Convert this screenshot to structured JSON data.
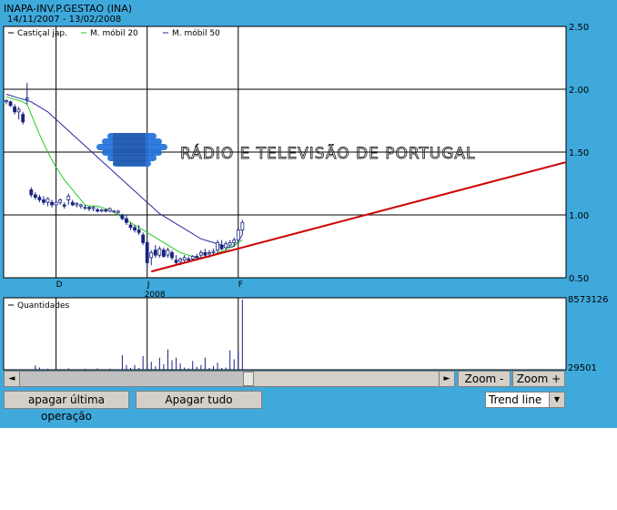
{
  "header": {
    "title": "INAPA-INV.P.GESTAO (INA)",
    "date_range": "14/11/2007 - 13/02/2008"
  },
  "legend": {
    "candles": "Castiçal jap.",
    "ma20": "M. móbil 20",
    "ma50": "M. móbil 50",
    "volume": "Quantidades"
  },
  "watermark_text": "RÁDIO E TELEVISÃO DE PORTUGAL",
  "colors": {
    "background": "#3fa9dc",
    "ma20": "#22cc22",
    "ma50": "#2a2a9a",
    "trend": "#cc0000",
    "candle": "#1a237e"
  },
  "controls": {
    "zoom_out": "Zoom -",
    "zoom_in": "Zoom +",
    "undo": "apagar última operação",
    "clear": "Apagar tudo",
    "tool_selected": "Trend line",
    "scroll_left": "◄",
    "scroll_right": "►",
    "dropdown_arrow": "▼"
  },
  "chart_data": [
    {
      "type": "candlestick",
      "title": "INAPA-INV.P.GESTAO (INA)",
      "subtitle": "14/11/2007 - 13/02/2008",
      "ylim": [
        0.5,
        2.5
      ],
      "yticks": [
        "2.50",
        "2.00",
        "1.50",
        "1.00",
        "0.50"
      ],
      "xticks": [
        {
          "label": "D",
          "index": 12
        },
        {
          "label": "J",
          "index": 34
        },
        {
          "label": "F",
          "index": 56
        }
      ],
      "year_label": "2008",
      "grid": true,
      "legend_position": "top-left",
      "ohlc": [
        [
          1.9,
          1.92,
          1.88,
          1.91
        ],
        [
          1.9,
          1.91,
          1.86,
          1.87
        ],
        [
          1.86,
          1.88,
          1.8,
          1.82
        ],
        [
          1.82,
          1.86,
          1.76,
          1.84
        ],
        [
          1.8,
          1.82,
          1.72,
          1.74
        ],
        [
          1.92,
          2.05,
          1.88,
          1.93
        ],
        [
          1.2,
          1.22,
          1.14,
          1.16
        ],
        [
          1.16,
          1.18,
          1.12,
          1.14
        ],
        [
          1.14,
          1.16,
          1.1,
          1.12
        ],
        [
          1.12,
          1.15,
          1.08,
          1.1
        ],
        [
          1.1,
          1.14,
          1.07,
          1.13
        ],
        [
          1.1,
          1.12,
          1.06,
          1.08
        ],
        [
          1.08,
          1.12,
          1.06,
          1.1
        ],
        [
          1.1,
          1.13,
          1.08,
          1.12
        ],
        [
          1.08,
          1.1,
          1.05,
          1.07
        ],
        [
          1.12,
          1.17,
          1.08,
          1.15
        ],
        [
          1.1,
          1.12,
          1.07,
          1.08
        ],
        [
          1.08,
          1.1,
          1.06,
          1.09
        ],
        [
          1.07,
          1.09,
          1.05,
          1.08
        ],
        [
          1.06,
          1.08,
          1.04,
          1.06
        ],
        [
          1.06,
          1.07,
          1.03,
          1.05
        ],
        [
          1.05,
          1.07,
          1.03,
          1.06
        ],
        [
          1.04,
          1.06,
          1.02,
          1.03
        ],
        [
          1.03,
          1.05,
          1.02,
          1.04
        ],
        [
          1.04,
          1.05,
          1.02,
          1.03
        ],
        [
          1.03,
          1.06,
          1.02,
          1.05
        ],
        [
          1.03,
          1.04,
          1.02,
          1.03
        ],
        [
          1.02,
          1.04,
          1.0,
          1.03
        ],
        [
          1.0,
          1.01,
          0.96,
          0.97
        ],
        [
          0.97,
          1.0,
          0.92,
          0.94
        ],
        [
          0.92,
          0.94,
          0.88,
          0.9
        ],
        [
          0.9,
          0.92,
          0.86,
          0.88
        ],
        [
          0.88,
          0.92,
          0.84,
          0.86
        ],
        [
          0.84,
          0.86,
          0.76,
          0.78
        ],
        [
          0.78,
          0.8,
          0.58,
          0.62
        ],
        [
          0.66,
          0.72,
          0.6,
          0.7
        ],
        [
          0.72,
          0.76,
          0.66,
          0.68
        ],
        [
          0.68,
          0.75,
          0.66,
          0.73
        ],
        [
          0.72,
          0.74,
          0.66,
          0.67
        ],
        [
          0.68,
          0.74,
          0.66,
          0.72
        ],
        [
          0.7,
          0.72,
          0.64,
          0.66
        ],
        [
          0.64,
          0.68,
          0.6,
          0.62
        ],
        [
          0.63,
          0.66,
          0.6,
          0.65
        ],
        [
          0.64,
          0.68,
          0.62,
          0.66
        ],
        [
          0.65,
          0.67,
          0.63,
          0.64
        ],
        [
          0.65,
          0.68,
          0.63,
          0.67
        ],
        [
          0.67,
          0.69,
          0.65,
          0.66
        ],
        [
          0.68,
          0.72,
          0.66,
          0.7
        ],
        [
          0.7,
          0.73,
          0.67,
          0.68
        ],
        [
          0.69,
          0.72,
          0.66,
          0.7
        ],
        [
          0.7,
          0.73,
          0.68,
          0.71
        ],
        [
          0.72,
          0.8,
          0.7,
          0.78
        ],
        [
          0.76,
          0.8,
          0.72,
          0.73
        ],
        [
          0.74,
          0.79,
          0.72,
          0.77
        ],
        [
          0.76,
          0.8,
          0.74,
          0.78
        ],
        [
          0.78,
          0.82,
          0.76,
          0.8
        ],
        [
          0.8,
          0.9,
          0.78,
          0.88
        ],
        [
          0.88,
          0.96,
          0.84,
          0.94
        ]
      ],
      "ma20": [
        1.94,
        1.93,
        1.92,
        1.91,
        1.9,
        1.88,
        1.8,
        1.72,
        1.64,
        1.57,
        1.5,
        1.44,
        1.38,
        1.33,
        1.28,
        1.24,
        1.2,
        1.16,
        1.12,
        1.08,
        1.07,
        1.07,
        1.07,
        1.06,
        1.05,
        1.04,
        1.02,
        1.0,
        0.98,
        0.96,
        0.94,
        0.92,
        0.9,
        0.88,
        0.86,
        0.84,
        0.82,
        0.8,
        0.78,
        0.76,
        0.74,
        0.72,
        0.7,
        0.69,
        0.68,
        0.67,
        0.66,
        0.66,
        0.66,
        0.67,
        0.68,
        0.7,
        0.71,
        0.72,
        0.74,
        0.76,
        0.78,
        0.8
      ],
      "ma50": [
        1.96,
        1.95,
        1.94,
        1.93,
        1.92,
        1.91,
        1.9,
        1.88,
        1.86,
        1.84,
        1.82,
        1.79,
        1.76,
        1.73,
        1.7,
        1.67,
        1.64,
        1.61,
        1.58,
        1.55,
        1.52,
        1.49,
        1.46,
        1.43,
        1.4,
        1.37,
        1.34,
        1.31,
        1.28,
        1.25,
        1.22,
        1.19,
        1.16,
        1.13,
        1.1,
        1.07,
        1.04,
        1.01,
        0.99,
        0.97,
        0.95,
        0.93,
        0.91,
        0.89,
        0.87,
        0.85,
        0.83,
        0.81,
        0.8,
        0.79,
        0.78,
        0.77,
        0.76,
        0.75,
        0.74,
        0.75,
        0.79,
        0.84
      ],
      "trend_line": {
        "from": [
          35,
          0.55
        ],
        "to_value_at_right_edge": 1.42
      }
    },
    {
      "type": "bar",
      "title": "Quantidades",
      "yticks": [
        "8573126",
        "29501"
      ],
      "ylim": [
        29501,
        8573126
      ],
      "values": [
        0,
        120000,
        0,
        0,
        0,
        0,
        0,
        550000,
        300000,
        0,
        150000,
        0,
        0,
        0,
        0,
        200000,
        0,
        0,
        0,
        150000,
        0,
        0,
        200000,
        0,
        0,
        150000,
        0,
        100000,
        1800000,
        600000,
        250000,
        600000,
        250000,
        1700000,
        800000,
        1000000,
        450000,
        1500000,
        700000,
        2500000,
        1200000,
        1500000,
        800000,
        300000,
        200000,
        1100000,
        400000,
        600000,
        1500000,
        250000,
        500000,
        900000,
        250000,
        300000,
        2400000,
        1300000,
        2300000,
        8573126
      ]
    }
  ]
}
